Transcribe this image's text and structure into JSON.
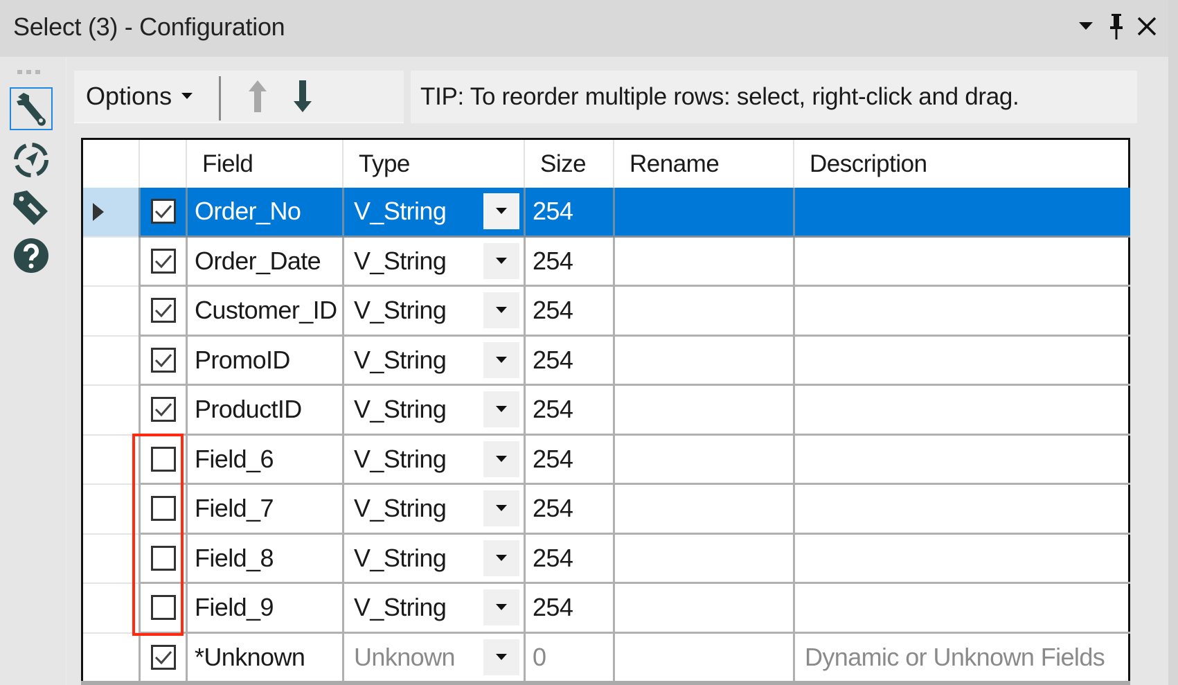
{
  "window": {
    "title": "Select (3) - Configuration",
    "controls": [
      "dropdown-icon",
      "pin-icon",
      "close-icon"
    ]
  },
  "sidebar": {
    "items": [
      {
        "icon": "wrench-icon",
        "label": "Configuration",
        "active": true
      },
      {
        "icon": "connection-progress-icon",
        "label": "Connection Progress",
        "active": false
      },
      {
        "icon": "tag-icon",
        "label": "Annotation",
        "active": false
      },
      {
        "icon": "help-icon",
        "label": "Help",
        "active": false
      }
    ]
  },
  "toolbar": {
    "options_label": "Options",
    "move_up_label": "Move up",
    "move_down_label": "Move down",
    "move_up_enabled": false,
    "move_down_enabled": true
  },
  "tip": "TIP: To reorder multiple rows: select, right-click and drag.",
  "grid": {
    "columns": [
      "",
      "",
      "Field",
      "Type",
      "Size",
      "Rename",
      "Description"
    ],
    "rows": [
      {
        "checked": true,
        "field": "Order_No",
        "type": "V_String",
        "size": "254",
        "rename": "",
        "description": "",
        "selected": true
      },
      {
        "checked": true,
        "field": "Order_Date",
        "type": "V_String",
        "size": "254",
        "rename": "",
        "description": ""
      },
      {
        "checked": true,
        "field": "Customer_ID",
        "type": "V_String",
        "size": "254",
        "rename": "",
        "description": ""
      },
      {
        "checked": true,
        "field": "PromoID",
        "type": "V_String",
        "size": "254",
        "rename": "",
        "description": ""
      },
      {
        "checked": true,
        "field": "ProductID",
        "type": "V_String",
        "size": "254",
        "rename": "",
        "description": ""
      },
      {
        "checked": false,
        "field": "Field_6",
        "type": "V_String",
        "size": "254",
        "rename": "",
        "description": ""
      },
      {
        "checked": false,
        "field": "Field_7",
        "type": "V_String",
        "size": "254",
        "rename": "",
        "description": ""
      },
      {
        "checked": false,
        "field": "Field_8",
        "type": "V_String",
        "size": "254",
        "rename": "",
        "description": ""
      },
      {
        "checked": false,
        "field": "Field_9",
        "type": "V_String",
        "size": "254",
        "rename": "",
        "description": ""
      },
      {
        "checked": true,
        "field": "*Unknown",
        "type": "Unknown",
        "size": "0",
        "rename": "",
        "description": "Dynamic or Unknown Fields",
        "dim": true
      }
    ]
  },
  "annotation": {
    "highlight_color": "#ff2a10",
    "highlight_rows": [
      "Field_6",
      "Field_7",
      "Field_8",
      "Field_9"
    ]
  },
  "colors": {
    "selection": "#0078d7",
    "row_header_selected": "#c2ddf2",
    "icon": "#2d4a4a"
  }
}
